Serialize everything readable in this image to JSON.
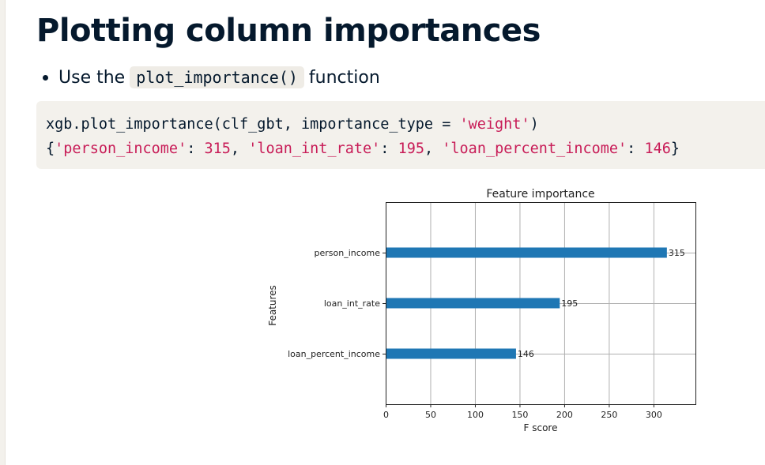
{
  "slide": {
    "title": "Plotting column importances",
    "bullet": {
      "prefix": "Use the",
      "code": "plot_importance()",
      "suffix": "function"
    }
  },
  "code_block": {
    "line1": {
      "pre": "xgb.plot_importance(clf_gbt, importance_type = ",
      "arg": "'weight'",
      "post": ")"
    },
    "line2": {
      "open": "{",
      "k1": "'person_income'",
      "sep1": ": ",
      "v1": "315",
      "c1": ", ",
      "k2": "'loan_int_rate'",
      "sep2": ": ",
      "v2": "195",
      "c2": ", ",
      "k3": "'loan_percent_income'",
      "sep3": ": ",
      "v3": "146",
      "close": "}"
    }
  },
  "colors": {
    "bar": "#1f77b4",
    "title_text": "#05192d",
    "code_string": "#c81c57",
    "code_bg": "#f3f1ec"
  },
  "chart_data": {
    "type": "bar",
    "orientation": "horizontal",
    "title": "Feature importance",
    "xlabel": "F score",
    "ylabel": "Features",
    "categories": [
      "person_income",
      "loan_int_rate",
      "loan_percent_income"
    ],
    "values": [
      315,
      195,
      146
    ],
    "value_labels": [
      "315",
      "195",
      "146"
    ],
    "xlim": [
      0,
      347
    ],
    "xticks": [
      0,
      50,
      100,
      150,
      200,
      250,
      300
    ],
    "xtick_labels": [
      "0",
      "50",
      "100",
      "150",
      "200",
      "250",
      "300"
    ],
    "grid": true
  }
}
